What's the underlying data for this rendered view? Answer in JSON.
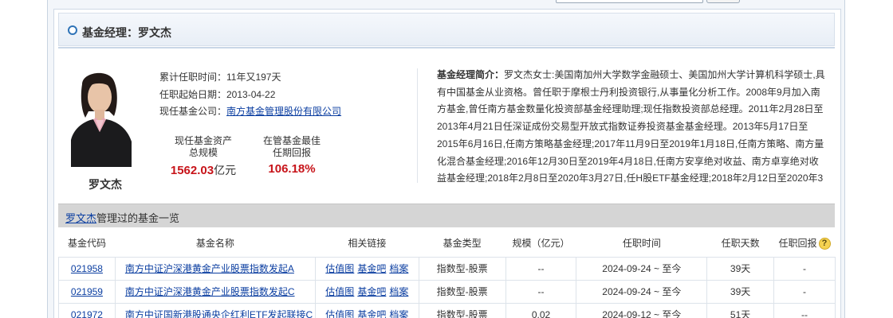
{
  "header": {
    "title": "基金经理：罗文杰"
  },
  "manager": {
    "name": "罗文杰",
    "tenure_total": "累计任职时间：11年又197天",
    "start_date": "任职起始日期：2013-04-22",
    "company_label": "现任基金公司：",
    "company": "南方基金管理股份有限公司",
    "assets_label_1": "现任基金资产",
    "assets_label_2": "总规模",
    "assets_value": "1562.03",
    "assets_unit": "亿元",
    "return_label_1": "在管基金最佳",
    "return_label_2": "任期回报",
    "return_value": "106.18%"
  },
  "bio": {
    "label": "基金经理简介：",
    "text": "罗文杰女士:美国南加州大学数学金融硕士、美国加州大学计算机科学硕士,具有中国基金从业资格。曾任职于摩根士丹利投资银行,从事量化分析工作。2008年9月加入南方基金,曾任南方基金数量化投资部基金经理助理;现任指数投资部总经理。2011年2月28日至2013年4月21日任深证成份交易型开放式指数证券投资基金基金经理。2013年5月17日至2015年6月16日,任南方策略基金经理;2017年11月9日至2019年1月18日,任南方策略、南方量化混合基金经理;2016年12月30日至2019年4月18日,任南方安享绝对收益、南方卓享绝对收益基金经理;2018年2月8日至2020年3月27日,任H股ETF基金经理;2018年2月12日至2020年3"
  },
  "fund_list": {
    "title_link": "罗文杰",
    "title_rest": "管理过的基金一览",
    "columns": [
      "基金代码",
      "基金名称",
      "相关链接",
      "基金类型",
      "规模（亿元）",
      "任职时间",
      "任职天数",
      "任职回报"
    ],
    "help_icon": "?",
    "rows": [
      {
        "code": "021958",
        "name": "南方中证沪深港黄金产业股票指数发起A",
        "links": [
          "估值图",
          "基金吧",
          "档案"
        ],
        "type": "指数型-股票",
        "size": "--",
        "period": "2024-09-24 ~ 至今",
        "days": "39天",
        "ret": "-"
      },
      {
        "code": "021959",
        "name": "南方中证沪深港黄金产业股票指数发起C",
        "links": [
          "估值图",
          "基金吧",
          "档案"
        ],
        "type": "指数型-股票",
        "size": "--",
        "period": "2024-09-24 ~ 至今",
        "days": "39天",
        "ret": "-"
      },
      {
        "code": "021972",
        "name": "南方中证国新港股通央企红利ETF发起联接C",
        "links": [
          "估值图",
          "基金吧",
          "档案"
        ],
        "type": "指数型-股票",
        "size": "0.02",
        "period": "2024-09-12 ~ 至今",
        "days": "51天",
        "ret": "--"
      }
    ]
  }
}
